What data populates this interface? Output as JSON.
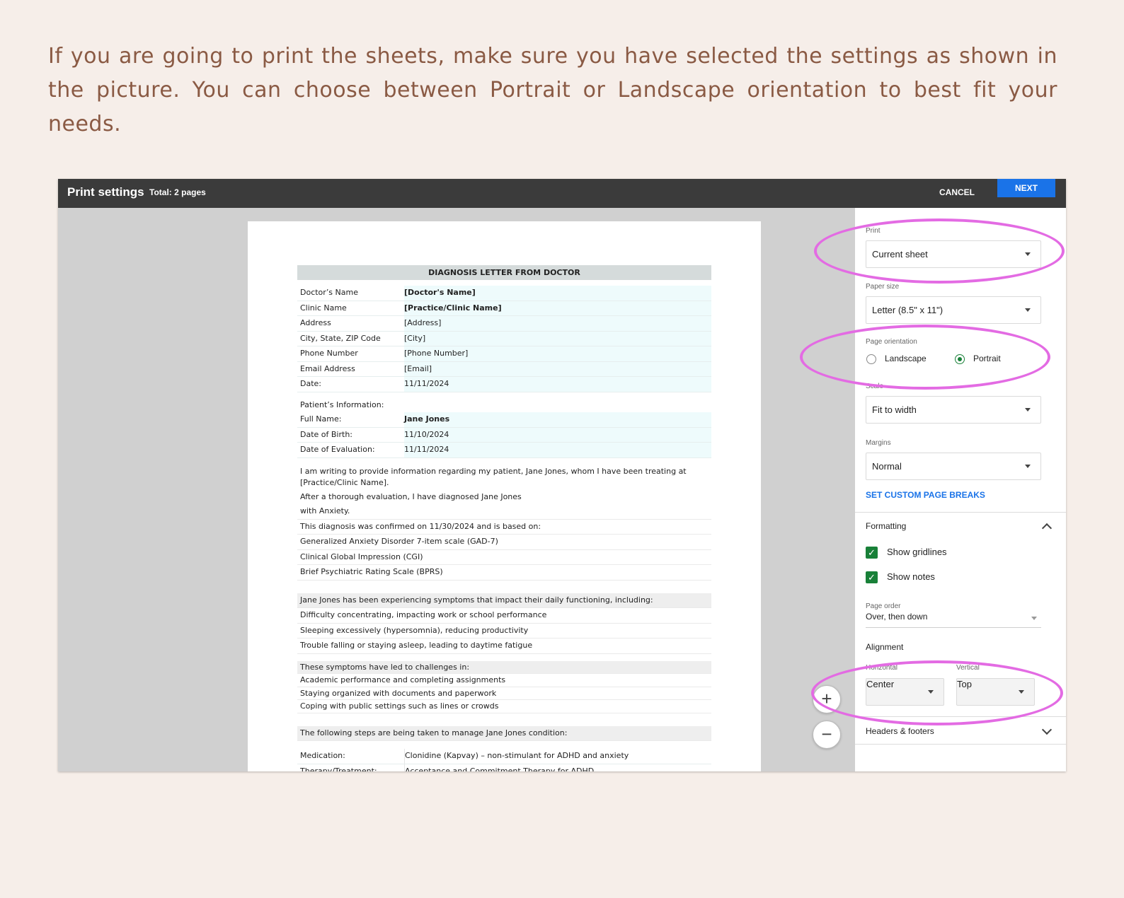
{
  "instruction": "If you are going to print the sheets, make sure you have selected the settings as shown in the picture. You can choose between Portrait or Landscape orientation to best fit your needs.",
  "topbar": {
    "title": "Print settings",
    "total": "Total: 2 pages",
    "cancel": "CANCEL",
    "next": "NEXT"
  },
  "document": {
    "title": "DIAGNOSIS LETTER FROM DOCTOR",
    "doctor_fields": [
      {
        "label": "Doctor’s Name",
        "value": "[Doctor's Name]"
      },
      {
        "label": "Clinic Name",
        "value": "[Practice/Clinic Name]"
      },
      {
        "label": "Address",
        "value": "[Address]"
      },
      {
        "label": "City, State, ZIP Code",
        "value": "[City]"
      },
      {
        "label": "Phone Number",
        "value": "[Phone Number]"
      },
      {
        "label": "Email Address",
        "value": "[Email]"
      },
      {
        "label": "Date:",
        "value": "11/11/2024"
      }
    ],
    "patient_heading": "Patient’s Information:",
    "patient_fields": [
      {
        "label": "Full Name:",
        "value": "Jane Jones"
      },
      {
        "label": "Date of Birth:",
        "value": "11/10/2024"
      },
      {
        "label": "Date of Evaluation:",
        "value": "11/11/2024"
      }
    ],
    "intro_text": "I am writing to provide information regarding my patient, Jane Jones, whom I have been treating at [Practice/Clinic Name].",
    "evaluation_line": "After a thorough evaluation, I have diagnosed Jane Jones",
    "with_line": "with   Anxiety.",
    "confirmed_line": "This diagnosis was confirmed on   11/30/2024   and is based on:",
    "basis": [
      "Generalized Anxiety Disorder 7-item scale (GAD-7)",
      "Clinical Global Impression (CGI)",
      "Brief Psychiatric Rating Scale (BPRS)"
    ],
    "symptoms_heading": "Jane Jones has been experiencing symptoms that impact their daily functioning, including:",
    "symptoms": [
      "Difficulty concentrating, impacting work or school performance",
      "Sleeping excessively (hypersomnia), reducing productivity",
      "Trouble falling or staying asleep, leading to daytime fatigue"
    ],
    "challenges_heading": "These symptoms have led to challenges in:",
    "challenges": [
      "Academic performance and completing assignments",
      "Staying organized with documents and paperwork",
      "Coping with public settings such as lines or crowds"
    ],
    "steps_heading": "The following steps are being taken to manage Jane Jones condition:",
    "steps": [
      {
        "label": "Medication:",
        "value": "Clonidine (Kapvay) – non-stimulant for ADHD and anxiety"
      },
      {
        "label": "Therapy/Treatment:",
        "value": "Acceptance and Commitment Therapy for ADHD"
      }
    ]
  },
  "zoom": {
    "in": "+",
    "out": "−"
  },
  "panel": {
    "print_label": "Print",
    "print_value": "Current sheet",
    "paper_label": "Paper size",
    "paper_value": "Letter (8.5\" x 11\")",
    "orientation_label": "Page orientation",
    "landscape": "Landscape",
    "portrait": "Portrait",
    "orientation_selected": "Portrait",
    "scale_label": "Scale",
    "scale_value": "Fit to width",
    "margins_label": "Margins",
    "margins_value": "Normal",
    "custom_breaks": "SET CUSTOM PAGE BREAKS",
    "formatting": "Formatting",
    "show_gridlines": "Show gridlines",
    "show_notes": "Show notes",
    "page_order_label": "Page order",
    "page_order_value": "Over, then down",
    "alignment": "Alignment",
    "horizontal_label": "Horizontal",
    "horizontal_value": "Center",
    "vertical_label": "Vertical",
    "vertical_value": "Top",
    "headers_footers": "Headers & footers"
  },
  "colors": {
    "background": "#f6eee9",
    "instruction_text": "#8a5a44",
    "topbar": "#3b3b3b",
    "primary_button": "#1a73e8",
    "checkbox": "#188038",
    "highlight_ellipse": "#e36be3"
  }
}
